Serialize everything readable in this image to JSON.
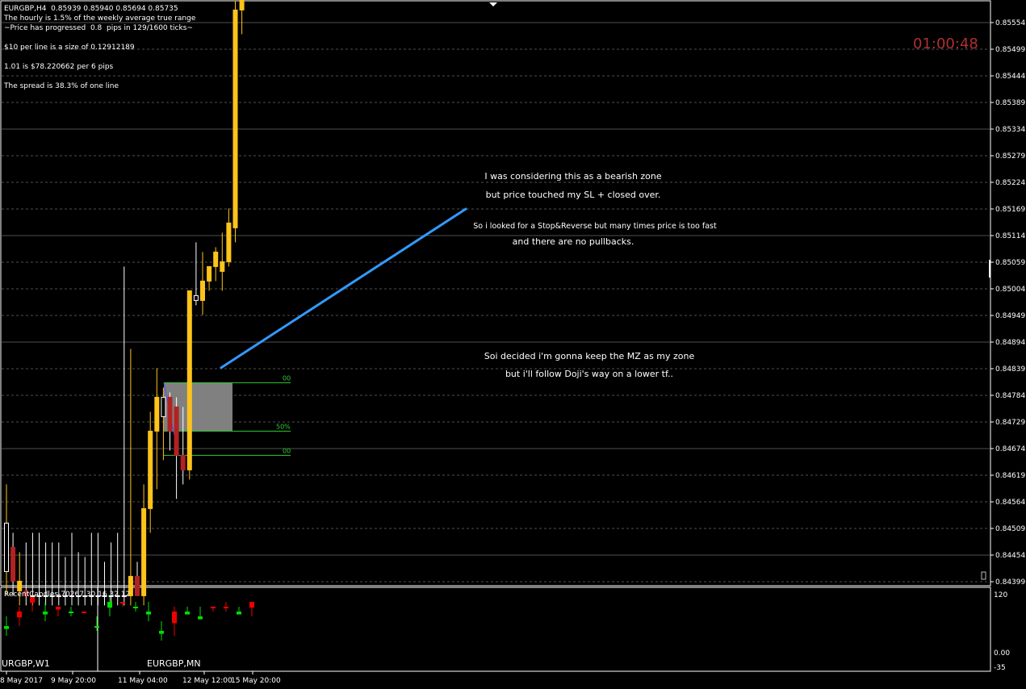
{
  "header": {
    "symbol_line": "EURGBP,H4  0.85939 0.85940 0.85694 0.85735",
    "hourly_line": "The hourly is 1.5% of the weekly average true range",
    "progress_line": "~Price has progressed  0.8  pips in 129/1600 ticks~",
    "size_line": "$10 per line is a size of 0.12912189",
    "lot_line": "1.01 is $78.220662 per 6 pips",
    "spread_line": "The spread is 38.3% of one line"
  },
  "timer": "01:00:48",
  "annotations": {
    "a1": "I was considering this as a bearish zone",
    "a2": "but price touched my SL + closed over.",
    "a3": "So i looked for a Stop&Reverse but many times price is too fast",
    "a4": "and there are no pullbacks.",
    "a5": "Soi decided i'm gonna keep the MZ as my zone",
    "a6": "but i'll follow Doji's way on a lower tf.."
  },
  "fib": {
    "top_label": "00",
    "mid_label": "50%",
    "bottom_label": "00"
  },
  "colors": {
    "bull": "#ffc31a",
    "bear": "#b22222",
    "trendline": "#3399ff",
    "fib": "#33cc33",
    "zone": "#808080",
    "timer": "#b03030"
  },
  "chart_data": {
    "type": "candlestick",
    "symbol": "EURGBP",
    "timeframe": "H4",
    "ylim": [
      0.8437,
      0.8561
    ],
    "y_ticks": [
      "0.85554",
      "0.85499",
      "0.85444",
      "0.85389",
      "0.85334",
      "0.85279",
      "0.85224",
      "0.85169",
      "0.85114",
      "0.85059",
      "0.85004",
      "0.84949",
      "0.84894",
      "0.84839",
      "0.84784",
      "0.84729",
      "0.84674",
      "0.84619",
      "0.84564",
      "0.84509",
      "0.84454",
      "0.84399"
    ],
    "x_ticks": [
      "8 May 2017",
      "9 May 20:00",
      "11 May 04:00",
      "12 May 12:00",
      "15 May 20:00"
    ],
    "ohlc": [
      [
        0.8442,
        0.846,
        0.8437,
        0.8452
      ],
      [
        0.8447,
        0.845,
        0.8437,
        0.844
      ],
      [
        0.8438,
        0.8446,
        0.8435,
        0.844
      ],
      [
        0.8438,
        0.8448,
        0.8435,
        0.8437
      ],
      [
        0.8437,
        0.845,
        0.8435,
        0.8437
      ],
      [
        0.8437,
        0.845,
        0.8435,
        0.8437
      ],
      [
        0.8437,
        0.8448,
        0.8435,
        0.8437
      ],
      [
        0.8437,
        0.8448,
        0.8435,
        0.8437
      ],
      [
        0.8437,
        0.8448,
        0.8435,
        0.8437
      ],
      [
        0.8437,
        0.8445,
        0.8435,
        0.8437
      ],
      [
        0.8437,
        0.845,
        0.8435,
        0.8437
      ],
      [
        0.8437,
        0.8446,
        0.8435,
        0.8437
      ],
      [
        0.8437,
        0.8445,
        0.8435,
        0.8437
      ],
      [
        0.8437,
        0.845,
        0.8435,
        0.8437
      ],
      [
        0.8437,
        0.845,
        0.8435,
        0.8437
      ],
      [
        0.8437,
        0.8444,
        0.8435,
        0.8437
      ],
      [
        0.8437,
        0.8448,
        0.8435,
        0.8437
      ],
      [
        0.8437,
        0.845,
        0.8435,
        0.8437
      ],
      [
        0.8437,
        0.8505,
        0.8435,
        0.8437
      ],
      [
        0.8437,
        0.8488,
        0.8435,
        0.8441
      ],
      [
        0.8441,
        0.8444,
        0.8437,
        0.8437
      ],
      [
        0.8437,
        0.846,
        0.8435,
        0.8455
      ],
      [
        0.8455,
        0.8475,
        0.845,
        0.8471
      ],
      [
        0.8471,
        0.8484,
        0.8459,
        0.8478
      ],
      [
        0.8474,
        0.848,
        0.8465,
        0.8478
      ],
      [
        0.8478,
        0.8479,
        0.8467,
        0.8471
      ],
      [
        0.8476,
        0.8478,
        0.8457,
        0.8466
      ],
      [
        0.8466,
        0.8476,
        0.846,
        0.8463
      ],
      [
        0.8463,
        0.85,
        0.8461,
        0.85
      ],
      [
        0.8499,
        0.851,
        0.8497,
        0.8498
      ],
      [
        0.8498,
        0.8508,
        0.8495,
        0.8502
      ],
      [
        0.8502,
        0.8505,
        0.85,
        0.8505
      ],
      [
        0.8505,
        0.8509,
        0.8502,
        0.8508
      ],
      [
        0.8504,
        0.8512,
        0.85,
        0.8506
      ],
      [
        0.8506,
        0.8517,
        0.8505,
        0.8514
      ],
      [
        0.8513,
        0.856,
        0.851,
        0.8558
      ],
      [
        0.8558,
        0.8563,
        0.8553,
        0.856
      ]
    ],
    "x_start": 8,
    "x_step": 8.1,
    "trendline": {
      "from": [
        273,
        0.8484
      ],
      "to": [
        578,
        0.8517
      ]
    },
    "zone": {
      "x1": 203,
      "x2": 288,
      "top": 0.8481,
      "bottom": 0.8471,
      "fib_low": 0.8466
    },
    "lower_panel": {
      "title": "RecentCandles-70267 30 16 32 12",
      "symbols": [
        "URGBP,W1",
        "EURGBP,MN"
      ],
      "y_ticks": [
        "120",
        "0.00",
        "-35"
      ],
      "w1": [
        [
          1,
          0.2,
          0.6,
          0.4
        ],
        [
          0,
          0.4,
          0.8,
          0.6
        ],
        [
          0,
          0.7,
          1.0,
          0.9
        ],
        [
          1,
          0.5,
          0.9,
          0.7
        ],
        [
          0,
          0.6,
          0.8,
          0.7
        ],
        [
          1,
          0.6,
          0.8,
          0.7
        ],
        [
          0,
          0.6,
          0.6,
          0.6
        ],
        [
          1,
          0.3,
          0.6,
          0.4
        ]
      ],
      "mn": [
        [
          1,
          0.6,
          1.0,
          0.9
        ],
        [
          0,
          0.8,
          0.9,
          0.8
        ],
        [
          1,
          0.7,
          0.9,
          0.8
        ],
        [
          1,
          0.5,
          0.9,
          0.7
        ],
        [
          1,
          0.1,
          0.5,
          0.3
        ],
        [
          0,
          0.2,
          0.8,
          0.6
        ],
        [
          1,
          0.7,
          0.8,
          0.7
        ],
        [
          1,
          0.6,
          0.8,
          0.6
        ],
        [
          0,
          0.7,
          0.8,
          0.7
        ],
        [
          0,
          0.7,
          0.9,
          0.7
        ],
        [
          1,
          0.7,
          0.8,
          0.7
        ],
        [
          0,
          0.6,
          0.8,
          0.8
        ]
      ]
    }
  }
}
